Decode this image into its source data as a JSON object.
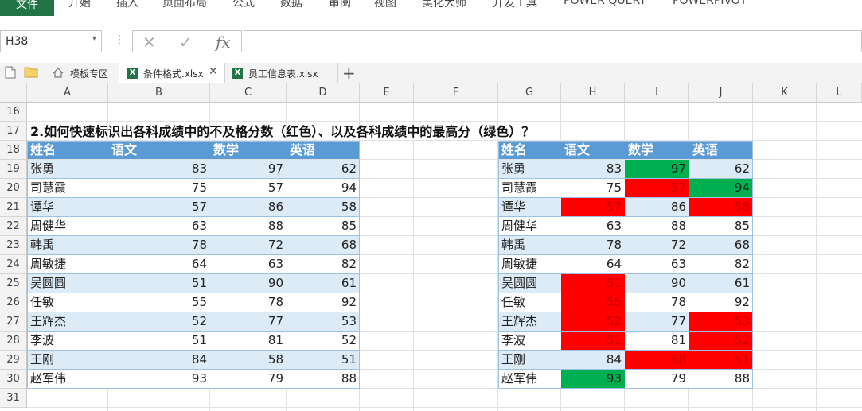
{
  "ribbon": {
    "tabs": [
      "文件",
      "开始",
      "插入",
      "页面布局",
      "公式",
      "数据",
      "审阅",
      "视图",
      "美化大师",
      "开发工具",
      "POWER QUERY",
      "POWERPIVOT"
    ]
  },
  "formula_bar": {
    "name_box": "H38",
    "cancel_icon": "✕",
    "enter_icon": "✓",
    "fx_label": "fx",
    "formula_value": ""
  },
  "file_tabs": {
    "template_label": "模板专区",
    "tabs": [
      {
        "label": "条件格式.xlsx",
        "active": true
      },
      {
        "label": "员工信息表.xlsx",
        "active": false
      }
    ],
    "add_label": "+"
  },
  "columns": [
    "A",
    "B",
    "C",
    "D",
    "E",
    "F",
    "G",
    "H",
    "I",
    "J",
    "K",
    "L"
  ],
  "rows": [
    "16",
    "17",
    "18",
    "19",
    "20",
    "21",
    "22",
    "23",
    "24",
    "25",
    "26",
    "27",
    "28",
    "29",
    "30",
    "31"
  ],
  "sheet": {
    "title": "2.如何快速标识出各科成绩中的不及格分数（红色）、以及各科成绩中的最高分（绿色）？",
    "headers": [
      "姓名",
      "语文",
      "数学",
      "英语"
    ],
    "records": [
      {
        "name": "张勇",
        "scores": [
          "83",
          "97",
          "62"
        ]
      },
      {
        "name": "司慧霞",
        "scores": [
          "75",
          "57",
          "94"
        ]
      },
      {
        "name": "谭华",
        "scores": [
          "57",
          "86",
          "58"
        ]
      },
      {
        "name": "周健华",
        "scores": [
          "63",
          "88",
          "85"
        ]
      },
      {
        "name": "韩禹",
        "scores": [
          "78",
          "72",
          "68"
        ]
      },
      {
        "name": "周敏捷",
        "scores": [
          "64",
          "63",
          "82"
        ]
      },
      {
        "name": "吴圆圆",
        "scores": [
          "51",
          "90",
          "61"
        ]
      },
      {
        "name": "任敏",
        "scores": [
          "55",
          "78",
          "92"
        ]
      },
      {
        "name": "王辉杰",
        "scores": [
          "52",
          "77",
          "53"
        ]
      },
      {
        "name": "李波",
        "scores": [
          "51",
          "81",
          "52"
        ]
      },
      {
        "name": "王刚",
        "scores": [
          "84",
          "58",
          "51"
        ]
      },
      {
        "name": "赵军伟",
        "scores": [
          "93",
          "79",
          "88"
        ]
      }
    ],
    "highlight_colors": {
      "fail": "#ff0000",
      "max": "#00b050",
      "header": "#5b9bd5",
      "band": "#ddebf7"
    },
    "right_table_highlights": [
      [
        "none",
        "max",
        "none"
      ],
      [
        "none",
        "fail",
        "max"
      ],
      [
        "fail",
        "none",
        "fail"
      ],
      [
        "none",
        "none",
        "none"
      ],
      [
        "none",
        "none",
        "none"
      ],
      [
        "none",
        "none",
        "none"
      ],
      [
        "fail",
        "none",
        "none"
      ],
      [
        "fail",
        "none",
        "none"
      ],
      [
        "fail",
        "none",
        "fail"
      ],
      [
        "fail",
        "none",
        "fail"
      ],
      [
        "none",
        "fail",
        "fail"
      ],
      [
        "max",
        "none",
        "none"
      ]
    ]
  }
}
